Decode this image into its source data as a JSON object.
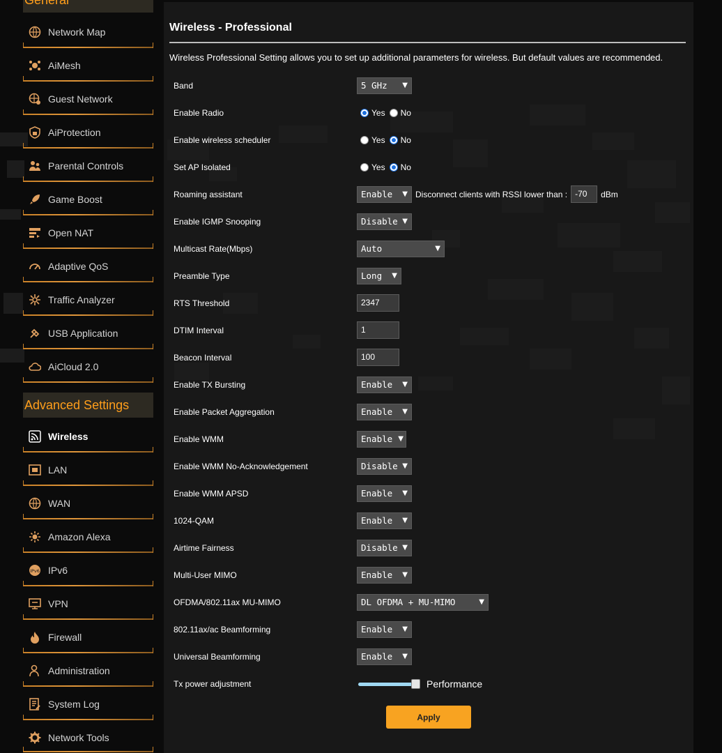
{
  "sidebar": {
    "general_header": "General",
    "advanced_header": "Advanced Settings",
    "general_items": [
      {
        "label": "Network Map",
        "icon": "network-map-icon"
      },
      {
        "label": "AiMesh",
        "icon": "aimesh-icon"
      },
      {
        "label": "Guest Network",
        "icon": "guest-network-icon"
      },
      {
        "label": "AiProtection",
        "icon": "lock-icon"
      },
      {
        "label": "Parental Controls",
        "icon": "parental-controls-icon"
      },
      {
        "label": "Game Boost",
        "icon": "rocket-icon"
      },
      {
        "label": "Open NAT",
        "icon": "open-nat-icon"
      },
      {
        "label": "Adaptive QoS",
        "icon": "gauge-icon"
      },
      {
        "label": "Traffic Analyzer",
        "icon": "traffic-analyzer-icon"
      },
      {
        "label": "USB Application",
        "icon": "usb-icon"
      },
      {
        "label": "AiCloud 2.0",
        "icon": "cloud-icon"
      }
    ],
    "advanced_items": [
      {
        "label": "Wireless",
        "icon": "wireless-icon"
      },
      {
        "label": "LAN",
        "icon": "lan-icon"
      },
      {
        "label": "WAN",
        "icon": "globe-icon"
      },
      {
        "label": "Amazon Alexa",
        "icon": "alexa-icon"
      },
      {
        "label": "IPv6",
        "icon": "ipv6-icon"
      },
      {
        "label": "VPN",
        "icon": "vpn-icon"
      },
      {
        "label": "Firewall",
        "icon": "fire-icon"
      },
      {
        "label": "Administration",
        "icon": "administration-icon"
      },
      {
        "label": "System Log",
        "icon": "system-log-icon"
      },
      {
        "label": "Network Tools",
        "icon": "gear-icon"
      }
    ]
  },
  "main": {
    "title": "Wireless - Professional",
    "description": "Wireless Professional Setting allows you to set up additional parameters for wireless. But default values are recommended.",
    "band": {
      "label": "Band",
      "value": "5 GHz"
    },
    "enable_radio": {
      "label": "Enable Radio",
      "yes": "Yes",
      "no": "No"
    },
    "wireless_scheduler": {
      "label": "Enable wireless scheduler",
      "yes": "Yes",
      "no": "No"
    },
    "ap_isolated": {
      "label": "Set AP Isolated",
      "yes": "Yes",
      "no": "No"
    },
    "roaming": {
      "label": "Roaming assistant",
      "value": "Enable",
      "text": "Disconnect clients with RSSI lower than :",
      "rssi": "-70",
      "unit": "dBm"
    },
    "igmp": {
      "label": "Enable IGMP Snooping",
      "value": "Disable"
    },
    "multicast": {
      "label": "Multicast Rate(Mbps)",
      "value": "Auto"
    },
    "preamble": {
      "label": "Preamble Type",
      "value": "Long"
    },
    "rts": {
      "label": "RTS Threshold",
      "value": "2347"
    },
    "dtim": {
      "label": "DTIM Interval",
      "value": "1"
    },
    "beacon": {
      "label": "Beacon Interval",
      "value": "100"
    },
    "tx_bursting": {
      "label": "Enable TX Bursting",
      "value": "Enable"
    },
    "packet_agg": {
      "label": "Enable Packet Aggregation",
      "value": "Enable"
    },
    "wmm": {
      "label": "Enable WMM",
      "value": "Enable"
    },
    "wmm_noack": {
      "label": "Enable WMM No-Acknowledgement",
      "value": "Disable"
    },
    "wmm_apsd": {
      "label": "Enable WMM APSD",
      "value": "Enable"
    },
    "qam": {
      "label": "1024-QAM",
      "value": "Enable"
    },
    "airtime": {
      "label": "Airtime Fairness",
      "value": "Disable"
    },
    "mumimo": {
      "label": "Multi-User MIMO",
      "value": "Enable"
    },
    "ofdma": {
      "label": "OFDMA/802.11ax MU-MIMO",
      "value": "DL OFDMA + MU-MIMO"
    },
    "beamforming": {
      "label": "802.11ax/ac Beamforming",
      "value": "Enable"
    },
    "universal_bf": {
      "label": "Universal Beamforming",
      "value": "Enable"
    },
    "tx_power": {
      "label": "Tx power adjustment",
      "text": "Performance",
      "level": 1.0
    },
    "apply_label": "Apply"
  },
  "colors": {
    "accent": "#ff9e1b",
    "apply": "#f8a321",
    "radio": "#1a6fe0"
  }
}
